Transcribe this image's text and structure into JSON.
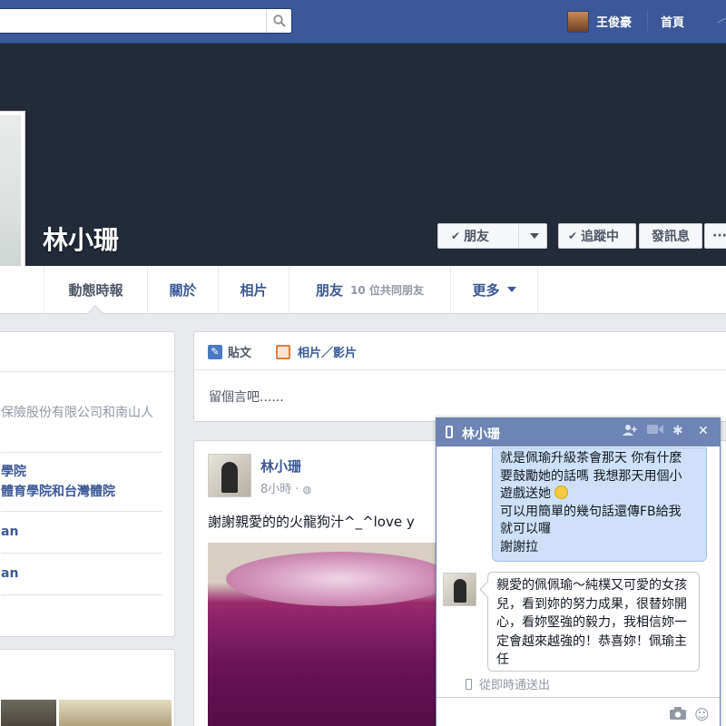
{
  "topbar": {
    "user_name": "王俊豪",
    "home_label": "首頁",
    "search_icon": "search-icon"
  },
  "profile": {
    "name": "林小珊",
    "buttons": {
      "friend": "朋友",
      "following": "追蹤中",
      "message": "發訊息",
      "more": "···"
    }
  },
  "tabs": {
    "timeline": "動態時報",
    "about": "關於",
    "photos": "相片",
    "friends": "朋友",
    "friends_sub": "10 位共同朋友",
    "more": "更多"
  },
  "left": {
    "items": [
      "保險股份有限公司和南山人",
      "學院",
      "體育學院和台灣體院",
      "an",
      "an"
    ]
  },
  "composer": {
    "post_label": "貼文",
    "photo_label": "相片／影片",
    "placeholder": "留個言吧......"
  },
  "post": {
    "author": "林小珊",
    "time": "8小時 · ",
    "text": "謝謝親愛的的火龍狗汁^_^love y"
  },
  "chat": {
    "title": "林小珊",
    "message_me": [
      "就是佩瑜升級茶會那天 你有什麼",
      "要鼓勵她的話嗎 我想那天用個小",
      "遊戲送她",
      "可以用簡單的幾句話還傳FB給我",
      "就可以囉",
      "謝謝拉"
    ],
    "message_them": "親愛的佩佩瑜～純樸又可愛的女孩兒，看到妳的努力成果，很替妳開心，看妳堅強的毅力，我相信妳一定會越來越強的！恭喜妳！佩瑜主任",
    "sent_via": "從即時通送出"
  },
  "colors": {
    "brand_blue": "#3b5998",
    "chat_header": "#6d84b4",
    "my_bubble": "#cfe1f8"
  }
}
